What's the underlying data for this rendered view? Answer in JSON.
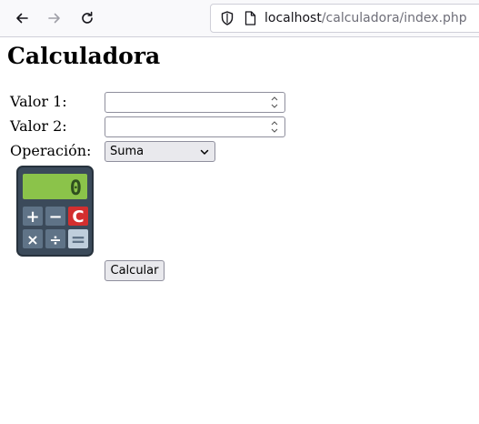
{
  "browser": {
    "url_host": "localhost",
    "url_path": "/calculadora/index.php"
  },
  "page": {
    "title": "Calculadora",
    "fields": {
      "valor1_label": "Valor 1:",
      "valor1_value": "",
      "valor2_label": "Valor 2:",
      "valor2_value": "",
      "operacion_label": "Operación:",
      "operacion_selected": "Suma"
    },
    "calculator_image": {
      "display_value": "0",
      "keys": [
        "+",
        "−",
        "C",
        "×",
        "÷",
        "="
      ]
    },
    "submit_label": "Calcular"
  },
  "colors": {
    "calc_body": "#3b4a5a",
    "calc_screen": "#8bc34a",
    "clear_key": "#d32f2f",
    "key": "#5f7387"
  }
}
